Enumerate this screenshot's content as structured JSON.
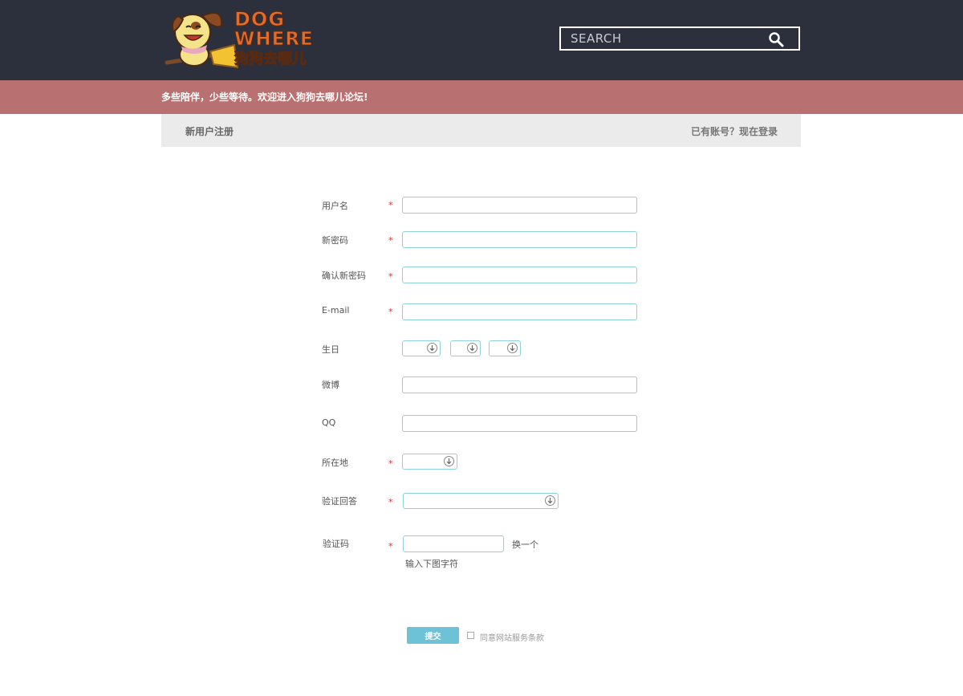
{
  "header": {
    "logo_text": [
      "DOG",
      "WHERE",
      "狗狗去哪儿"
    ],
    "search_placeholder": "SEARCH",
    "search_icon": "search-icon",
    "colors": {
      "topbar": "#2b303c",
      "banner": "#b87170",
      "accent": "#6ec2d6",
      "required": "#dd3333"
    }
  },
  "banner": {
    "text": "多些陪伴，少些等待。欢迎进入狗狗去哪儿论坛!"
  },
  "subbar": {
    "title": "新用户注册",
    "login_link": "已有账号？现在登录"
  },
  "form": {
    "required_mark": "*",
    "username_label": "用户名",
    "password_label": "新密码",
    "confirm_label": "确认新密码",
    "email_label": "E-mail",
    "birthday_label": "生日",
    "weibo_label": "微博",
    "qq_label": "QQ",
    "location_label": "所在地",
    "answer_label": "验证回答",
    "captcha_label": "验证码",
    "captcha_refresh": "换一个",
    "captcha_hint": "输入下图字符",
    "dropdown_icon": "chevron-down-circle-icon"
  },
  "footer": {
    "submit_label": "提交",
    "agree_text": "同意网站服务条款"
  }
}
